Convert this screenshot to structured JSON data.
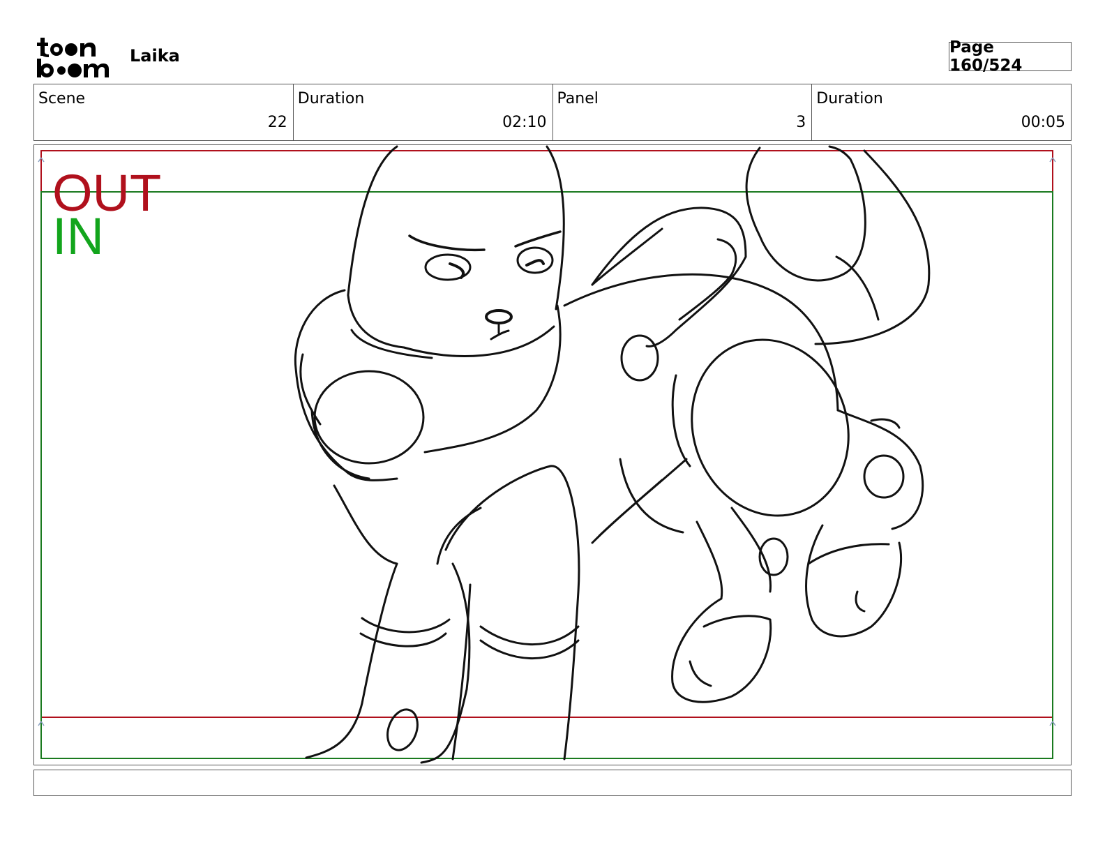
{
  "header": {
    "logo_alt": "toon boom",
    "project_title": "Laika",
    "page_indicator": "Page 160/524"
  },
  "info": {
    "scene_label": "Scene",
    "scene_value": "22",
    "scene_duration_label": "Duration",
    "scene_duration_value": "02:10",
    "panel_label": "Panel",
    "panel_value": "3",
    "panel_duration_label": "Duration",
    "panel_duration_value": "00:05"
  },
  "panel": {
    "out_label": "OUT",
    "in_label": "IN",
    "out_color": "#b0101c",
    "in_color": "#12a51c",
    "artwork": "sketch-of-robot-dog"
  },
  "notes": {
    "text": ""
  }
}
